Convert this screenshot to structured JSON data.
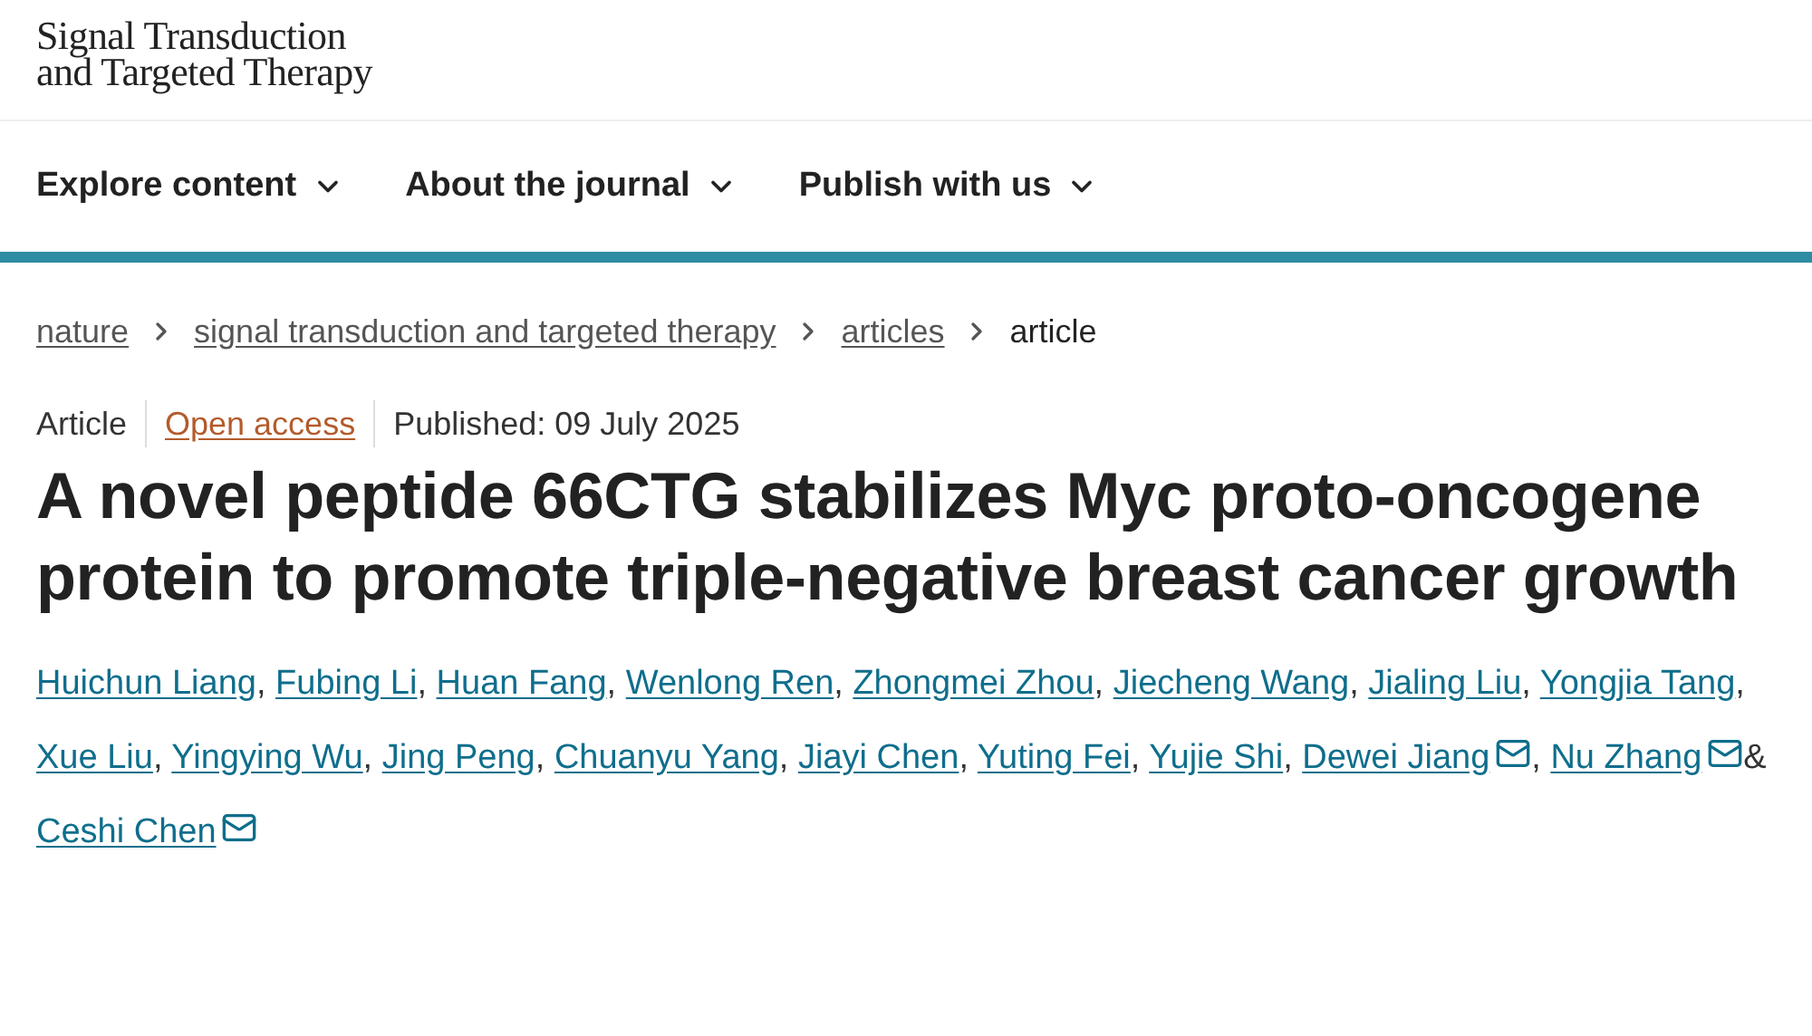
{
  "logo": {
    "line_1": "Signal Transduction",
    "line_2": "and Targeted Therapy"
  },
  "nav": [
    {
      "label": "Explore content"
    },
    {
      "label": "About the journal"
    },
    {
      "label": "Publish with us"
    }
  ],
  "breadcrumbs": [
    {
      "label": "nature",
      "current": false
    },
    {
      "label": "signal transduction and targeted therapy",
      "current": false
    },
    {
      "label": "articles",
      "current": false
    },
    {
      "label": "article",
      "current": true
    }
  ],
  "meta": {
    "type": "Article",
    "access": "Open access",
    "published": "Published: 09 July 2025"
  },
  "title": "A novel peptide 66CTG stabilizes Myc proto-oncogene protein to promote triple-negative breast cancer growth",
  "authors": [
    {
      "name": "Huichun Liang",
      "email": false,
      "separator": ","
    },
    {
      "name": "Fubing Li",
      "email": false,
      "separator": ","
    },
    {
      "name": "Huan Fang",
      "email": false,
      "separator": ","
    },
    {
      "name": "Wenlong Ren",
      "email": false,
      "separator": ","
    },
    {
      "name": "Zhongmei Zhou",
      "email": false,
      "separator": ","
    },
    {
      "name": "Jiecheng Wang",
      "email": false,
      "separator": ","
    },
    {
      "name": "Jialing Liu",
      "email": false,
      "separator": ","
    },
    {
      "name": "Yongjia Tang",
      "email": false,
      "separator": ","
    },
    {
      "name": "Xue Liu",
      "email": false,
      "separator": ","
    },
    {
      "name": "Yingying Wu",
      "email": false,
      "separator": ","
    },
    {
      "name": "Jing Peng",
      "email": false,
      "separator": ","
    },
    {
      "name": "Chuanyu Yang",
      "email": false,
      "separator": ","
    },
    {
      "name": "Jiayi Chen",
      "email": false,
      "separator": ","
    },
    {
      "name": "Yuting Fei",
      "email": false,
      "separator": ","
    },
    {
      "name": "Yujie Shi",
      "email": false,
      "separator": ","
    },
    {
      "name": "Dewei Jiang",
      "email": true,
      "separator": ","
    },
    {
      "name": "Nu Zhang",
      "email": true,
      "separator": "&"
    },
    {
      "name": "Ceshi Chen",
      "email": true
    }
  ]
}
